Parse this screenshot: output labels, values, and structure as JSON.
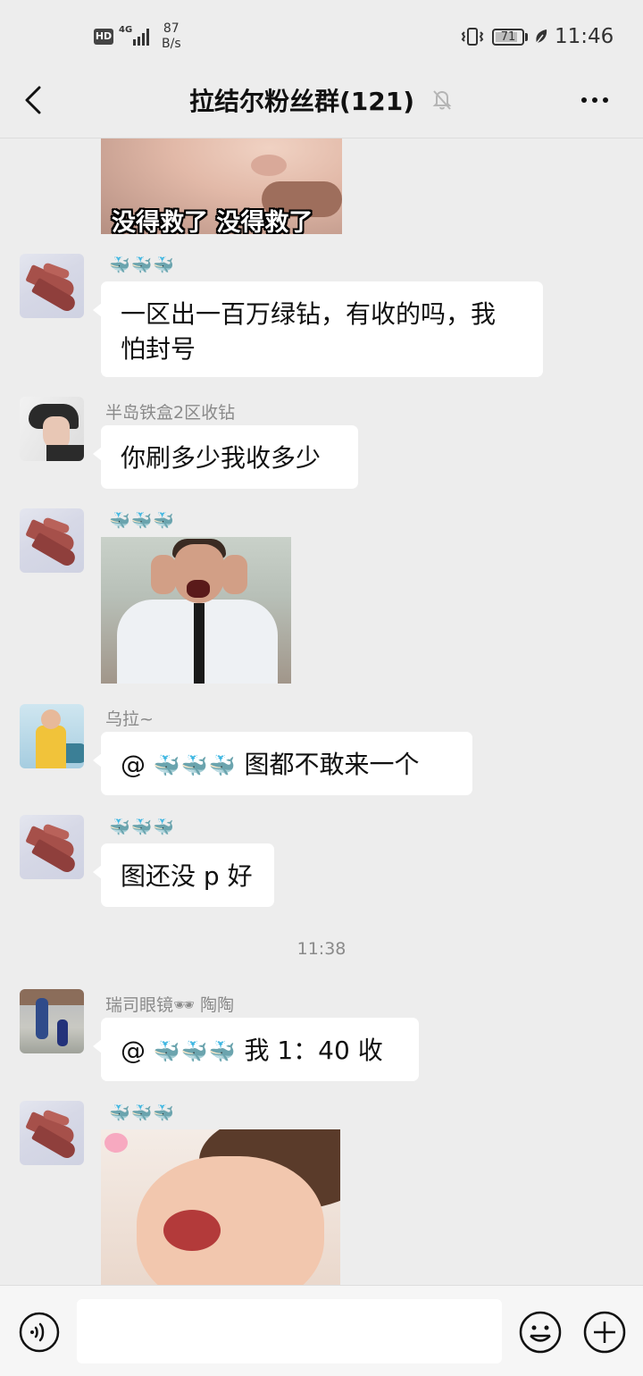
{
  "status_bar": {
    "hd": "HD",
    "network": "4G",
    "speed_value": "87",
    "speed_unit": "B/s",
    "battery": "71",
    "time": "11:46"
  },
  "header": {
    "title": "拉结尔粉丝群(121)",
    "icons": [
      "back-icon",
      "mute-bell-icon",
      "more-icon"
    ]
  },
  "messages": [
    {
      "type": "image",
      "sender": "",
      "caption": "没得救了 没得救了",
      "image": "crying-baby-sticker"
    },
    {
      "type": "text",
      "sender": "🐳🐳🐳",
      "text_line1": "一区出一百万绿钻，有收的吗，我",
      "text_line2": "怕封号"
    },
    {
      "type": "text",
      "sender": "半岛铁盒2区收钻",
      "text": "你刷多少我收多少"
    },
    {
      "type": "image",
      "sender": "🐳🐳🐳",
      "image": "laughing-man-gif"
    },
    {
      "type": "text",
      "sender": "乌拉~",
      "mention": "@",
      "mention_name": "🐳🐳🐳",
      "text": " 图都不敢来一个"
    },
    {
      "type": "text",
      "sender": "🐳🐳🐳",
      "text": "图还没 p 好"
    },
    {
      "type": "timestamp",
      "text": "11:38"
    },
    {
      "type": "text",
      "sender": "瑞司眼镜🕶 陶陶",
      "mention": "@",
      "mention_name": "🐳🐳🐳",
      "text": " 我 1：40 收"
    },
    {
      "type": "image",
      "sender": "🐳🐳🐳",
      "image": "laughing-baby-sticker"
    }
  ],
  "input_bar": {
    "icons": [
      "voice-icon",
      "emoji-icon",
      "plus-icon"
    ],
    "placeholder": ""
  }
}
